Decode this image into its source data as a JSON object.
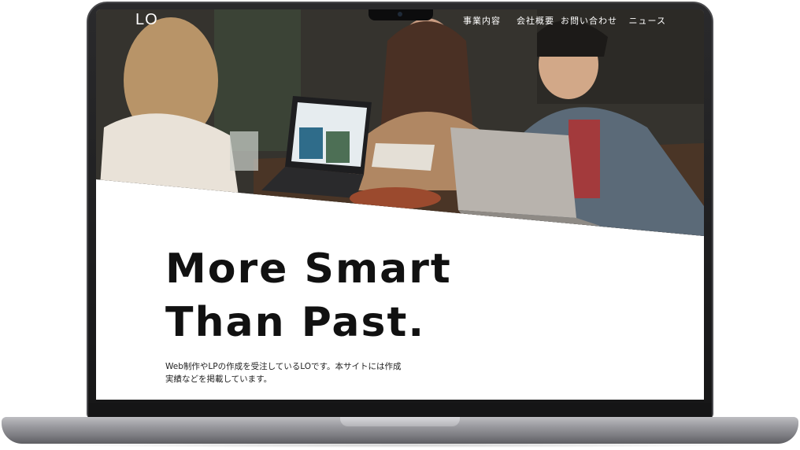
{
  "site": {
    "logo": "LO",
    "nav": [
      {
        "label": "事業内容"
      },
      {
        "label": "会社概要"
      },
      {
        "label": "お問い合わせ"
      },
      {
        "label": "ニュース"
      }
    ]
  },
  "hero": {
    "headline_line1": "More Smart",
    "headline_line2": "Than Past.",
    "lead": "Web制作やLPの作成を受注しているLOです。本サイトには作成実績などを掲載しています。"
  },
  "colors": {
    "headline": "#111111",
    "nav_text": "#ffffff",
    "device_frame": "#1c1c1e",
    "device_base": "#9a9a9f"
  },
  "icons": {
    "camera": "camera-icon"
  }
}
